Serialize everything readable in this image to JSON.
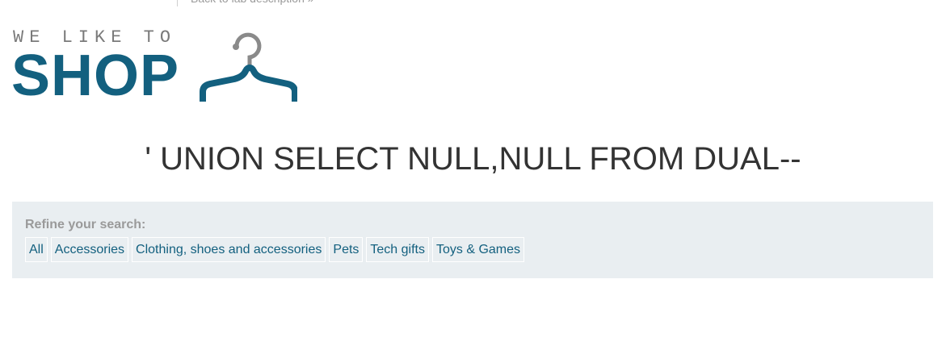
{
  "header": {
    "back_link": "Back to lab description »"
  },
  "logo": {
    "tagline": "WE LIKE TO",
    "brand": "SHOP",
    "icon": "hanger-icon",
    "color": "#13607f"
  },
  "main": {
    "heading": "' UNION SELECT NULL,NULL FROM DUAL--"
  },
  "filters": {
    "label": "Refine your search:",
    "items": [
      {
        "label": "All"
      },
      {
        "label": "Accessories"
      },
      {
        "label": "Clothing, shoes and accessories"
      },
      {
        "label": "Pets"
      },
      {
        "label": "Tech gifts"
      },
      {
        "label": "Toys & Games"
      }
    ],
    "panel_color": "#e9eef1",
    "link_color": "#13607f"
  }
}
